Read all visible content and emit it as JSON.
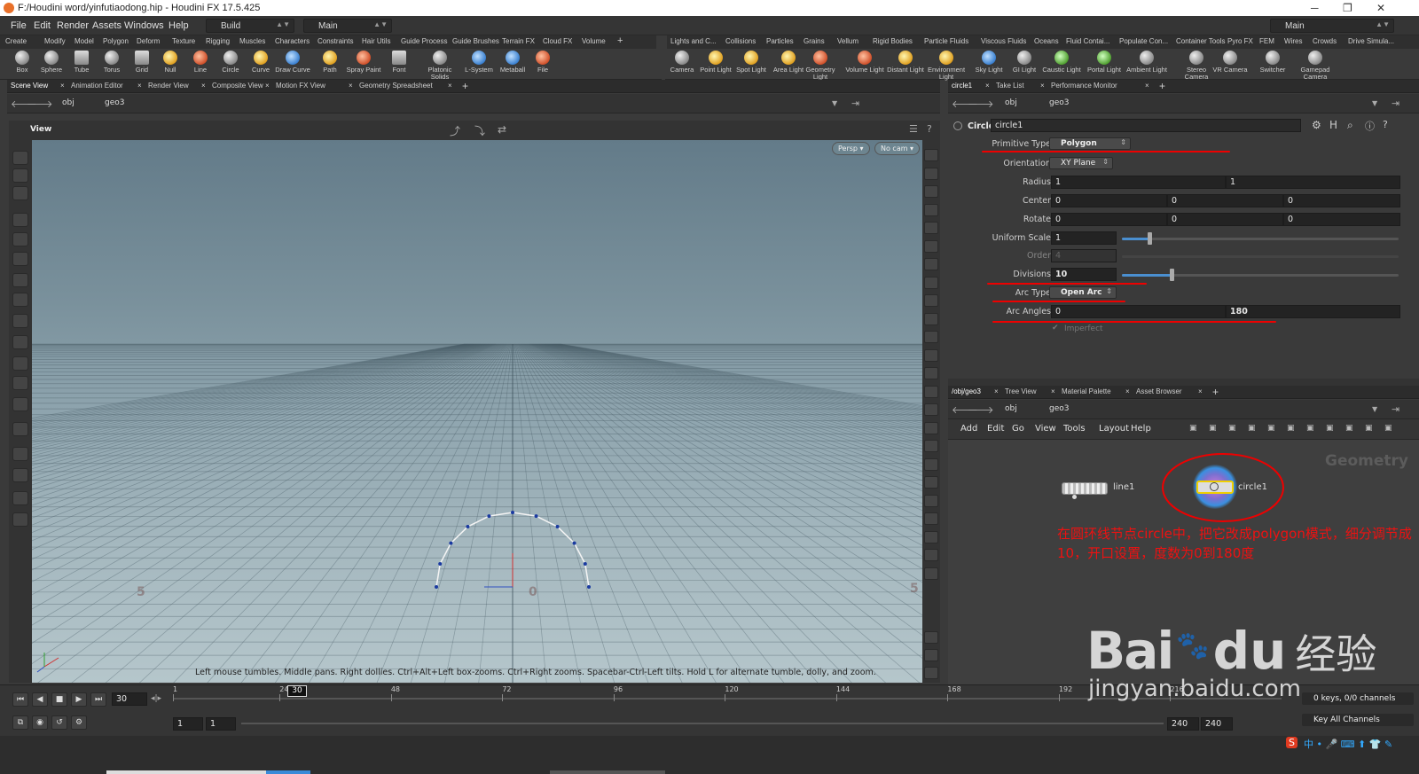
{
  "window": {
    "title": "F:/Houdini word/yinfutiaodong.hip - Houdini FX 17.5.425"
  },
  "menu": [
    "File",
    "Edit",
    "Render",
    "Assets",
    "Windows",
    "Help"
  ],
  "desktop_left": "Build",
  "desktop_mid": "Main",
  "desktop_right": "Main",
  "shelf_tabs_left": [
    "Create",
    "Modify",
    "Model",
    "Polygon",
    "Deform",
    "Texture",
    "Rigging",
    "Muscles",
    "Characters",
    "Constraints",
    "Hair Utils",
    "Guide Process",
    "Guide Brushes",
    "Terrain FX",
    "Cloud FX",
    "Volume"
  ],
  "shelf_tabs_right": [
    "Lights and C...",
    "Collisions",
    "Particles",
    "Grains",
    "Vellum",
    "Rigid Bodies",
    "Particle Fluids",
    "Viscous Fluids",
    "Oceans",
    "Fluid Contai...",
    "Populate Con...",
    "Container Tools",
    "Pyro FX",
    "FEM",
    "Wires",
    "Crowds",
    "Drive Simula..."
  ],
  "tools_left": [
    "Box",
    "Sphere",
    "Tube",
    "Torus",
    "Grid",
    "Null",
    "Line",
    "Circle",
    "Curve",
    "Draw Curve",
    "Path",
    "Spray Paint",
    "Font",
    "Platonic Solids",
    "L-System",
    "Metaball",
    "File"
  ],
  "tools_right": [
    "Camera",
    "Point Light",
    "Spot Light",
    "Area Light",
    "Geometry Light",
    "Volume Light",
    "Distant Light",
    "Environment Light",
    "Sky Light",
    "GI Light",
    "Caustic Light",
    "Portal Light",
    "Ambient Light",
    "Stereo Camera",
    "VR Camera",
    "Switcher",
    "Gamepad Camera"
  ],
  "left_pane_tabs": [
    "Scene View",
    "Animation Editor",
    "Render View",
    "Composite View",
    "Motion FX View",
    "Geometry Spreadsheet"
  ],
  "path": {
    "root": "obj",
    "node": "geo3"
  },
  "view": {
    "label": "View",
    "persp": "Persp",
    "cam": "No cam",
    "hint": "Left mouse tumbles. Middle pans. Right dollies. Ctrl+Alt+Left box-zooms. Ctrl+Right zooms. Spacebar-Ctrl-Left tilts. Hold L for alternate tumble, dolly, and zoom.",
    "grid_labels": [
      "5",
      "0",
      "5"
    ]
  },
  "param_tabs": [
    "circle1",
    "Take List",
    "Performance Monitor"
  ],
  "node": {
    "type": "Circle",
    "name": "circle1"
  },
  "params": {
    "primitive_type": {
      "label": "Primitive Type",
      "value": "Polygon"
    },
    "orientation": {
      "label": "Orientation",
      "value": "XY Plane"
    },
    "radius": {
      "label": "Radius",
      "v1": "1",
      "v2": "1"
    },
    "center": {
      "label": "Center",
      "v1": "0",
      "v2": "0",
      "v3": "0"
    },
    "rotate": {
      "label": "Rotate",
      "v1": "0",
      "v2": "0",
      "v3": "0"
    },
    "uniform_scale": {
      "label": "Uniform Scale",
      "value": "1",
      "slider": 0.1
    },
    "order": {
      "label": "Order",
      "value": "4"
    },
    "divisions": {
      "label": "Divisions",
      "value": "10",
      "slider": 0.18
    },
    "arc_type": {
      "label": "Arc Type",
      "value": "Open Arc"
    },
    "arc_angles": {
      "label": "Arc Angles",
      "v1": "0",
      "v2": "180"
    },
    "imperfect": {
      "label": "Imperfect"
    }
  },
  "net_tabs": [
    "/obj/geo3",
    "Tree View",
    "Material Palette",
    "Asset Browser"
  ],
  "net_menu": [
    "Add",
    "Edit",
    "Go",
    "View",
    "Tools",
    "Layout",
    "Help"
  ],
  "net": {
    "context": "Geometry",
    "nodes": [
      "line1",
      "circle1"
    ]
  },
  "annotation": "在圆环线节点circle中，把它改成polygon模式，细分调节成10，开口设置，度数为0到180度",
  "timeline": {
    "frame": "30",
    "marker": "30",
    "ticks": [
      "1",
      "24",
      "48",
      "72",
      "96",
      "120",
      "144",
      "168",
      "192",
      "216"
    ],
    "start": "1",
    "start2": "1",
    "end": "240",
    "end2": "240",
    "keys": "0 keys, 0/0 channels",
    "key_all": "Key All Channels"
  },
  "watermark": {
    "brand": "Bai",
    "brand2": "du",
    "cn": "经验",
    "url": "jingyan.baidu.com"
  },
  "colors": {
    "accent": "#4a8fd0",
    "annotation": "#e11111"
  }
}
